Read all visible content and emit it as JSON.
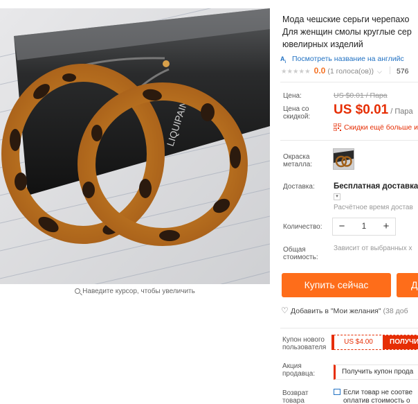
{
  "product": {
    "title_lines": [
      "Мода чешские серьги черепахо",
      "Для женщин смолы круглые сер",
      "ювелирных изделий"
    ],
    "translate_link": "Посмотреть название на английс",
    "rating_stars": 0,
    "rating_score": "0.0",
    "votes": "(1 голоса(ов))",
    "orders": "576"
  },
  "gallery": {
    "zoom_hint": "Наведите курсор, чтобы увеличить"
  },
  "price": {
    "label": "Цена:",
    "original": "US $0.01 / Пара",
    "sale_label_line1": "Цена со",
    "sale_label_line2": "скидкой:",
    "sale_amount": "US $0.01",
    "sale_unit": "/ Пара",
    "promo": "Скидки ещё больше и"
  },
  "options": {
    "metal_label_line1": "Окраска",
    "metal_label_line2": "металла:"
  },
  "shipping": {
    "label": "Доставка:",
    "value": "Бесплатная доставка в",
    "time": "Расчётное время достав"
  },
  "quantity": {
    "label": "Количество:",
    "value": "1",
    "minus": "−",
    "plus": "+"
  },
  "total": {
    "label_line1": "Общая",
    "label_line2": "стоимость:",
    "value": "Зависит от выбранных х"
  },
  "actions": {
    "buy_now": "Купить сейчас",
    "add_to_cart": "Д",
    "wishlist": "Добавить в \"Мои желания\"",
    "wishlist_count": "(38 доб"
  },
  "coupons": {
    "new_user_label_line1": "Купон нового",
    "new_user_label_line2": "пользователя",
    "new_user_amount": "US $4.00",
    "new_user_get": "ПОЛУЧИ",
    "seller_label_line1": "Акция",
    "seller_label_line2": "продавца:",
    "seller_coupon": "Получить купон прода"
  },
  "returns": {
    "label_line1": "Возврат",
    "label_line2": "товара",
    "text_line1": "Если товар не соотве",
    "text_line2": "оплатив стоимость о"
  },
  "colors": {
    "accent": "#fe6d1a",
    "price_red": "#e62e04",
    "link_blue": "#2272c3"
  }
}
